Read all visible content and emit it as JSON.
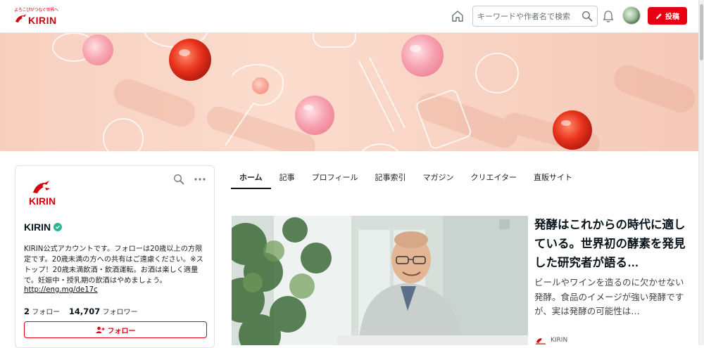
{
  "header": {
    "logo_tagline": "よろこびがつなぐ世界へ",
    "logo_brand": "KIRIN",
    "search_placeholder": "キーワードや作者名で検索",
    "post_label": "投稿"
  },
  "profile": {
    "logo_brand": "KIRIN",
    "name": "KIRIN",
    "bio": "KIRIN公式アカウントです。フォローは20歳以上の方限定です。20歳未満の方への共有はご遠慮ください。※ストップ！20歳未満飲酒・飲酒運転。お酒は楽しく適量で。妊娠中・授乳期の飲酒はやめましょう。",
    "link": "http://eng.mg/de17c",
    "following_count": "2",
    "following_label": "フォロー",
    "followers_count": "14,707",
    "followers_label": "フォロワー",
    "follow_button": "フォロー"
  },
  "tabs": [
    {
      "label": "ホーム",
      "active": true
    },
    {
      "label": "記事"
    },
    {
      "label": "プロフィール"
    },
    {
      "label": "記事索引"
    },
    {
      "label": "マガジン"
    },
    {
      "label": "クリエイター"
    },
    {
      "label": "直販サイト"
    }
  ],
  "feature": {
    "title": "発酵はこれからの時代に適している。世界初の酵素を発見した研究者が語る…",
    "excerpt": "ビールやワインを造るのに欠かせない発酵。食品のイメージが強い発酵ですが、実は発酵の可能性は…",
    "author": "KIRIN"
  },
  "colors": {
    "accent": "#e60012",
    "brand_red": "#d4000d",
    "verified": "#2cb696"
  },
  "icons": [
    "home-icon",
    "search-icon",
    "bell-icon",
    "pen-icon",
    "more-icon",
    "verified-icon",
    "person-plus-icon"
  ]
}
